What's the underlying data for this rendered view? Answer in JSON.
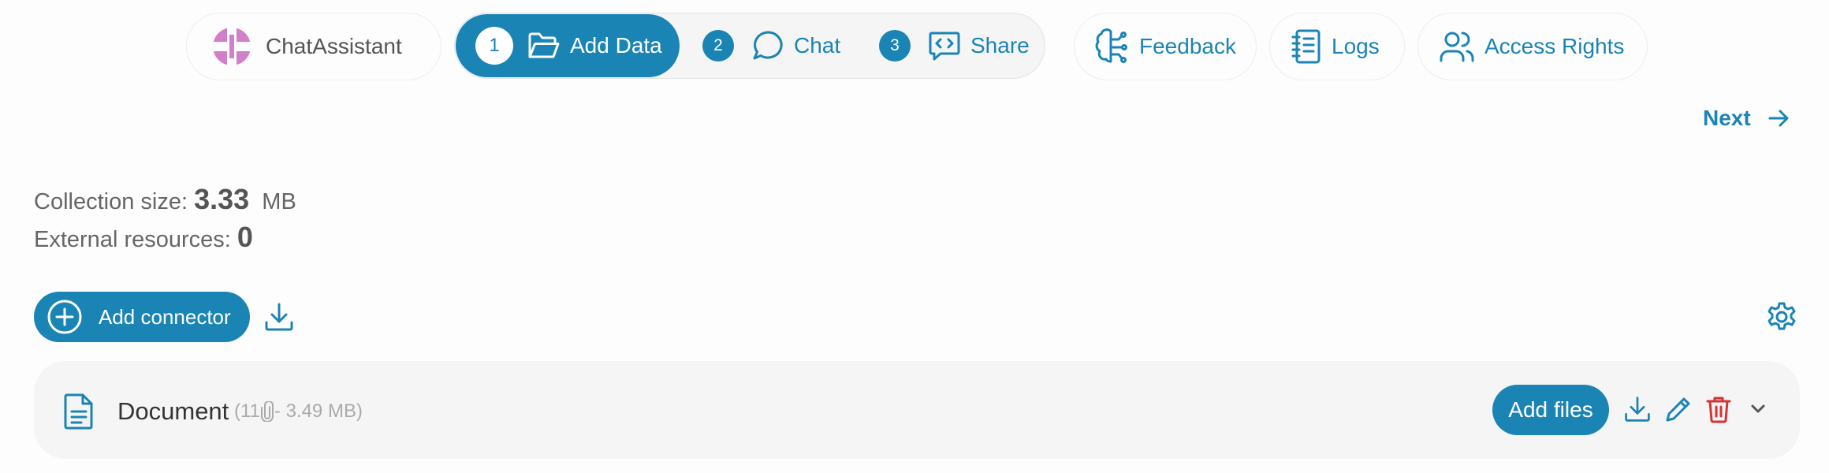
{
  "header": {
    "app_name": "ChatAssistant",
    "steps": [
      {
        "number": "1",
        "label": "Add Data"
      },
      {
        "number": "2",
        "label": "Chat"
      },
      {
        "number": "3",
        "label": "Share"
      }
    ],
    "feedback_label": "Feedback",
    "logs_label": "Logs",
    "access_label": "Access Rights"
  },
  "nav": {
    "next_label": "Next"
  },
  "stats": {
    "size_label": "Collection size:",
    "size_value": "3.33",
    "size_unit": "MB",
    "external_label": "External resources:",
    "external_value": "0"
  },
  "toolbar": {
    "add_connector_label": "Add connector"
  },
  "document": {
    "name": "Document",
    "meta_prefix": "(11",
    "meta_suffix": "- 3.49 MB)",
    "add_files_label": "Add files"
  },
  "colors": {
    "accent": "#1a84b5",
    "danger": "#d33535",
    "logo": "#d27fc9"
  },
  "icons": [
    "app-logo-icon",
    "folder-open-icon",
    "chat-bubble-icon",
    "code-share-icon",
    "brain-icon",
    "notebook-icon",
    "users-icon",
    "arrow-right-icon",
    "plus-circle-icon",
    "download-icon",
    "gear-icon",
    "document-icon",
    "paperclip-icon",
    "pencil-icon",
    "trash-icon",
    "chevron-down-icon"
  ]
}
